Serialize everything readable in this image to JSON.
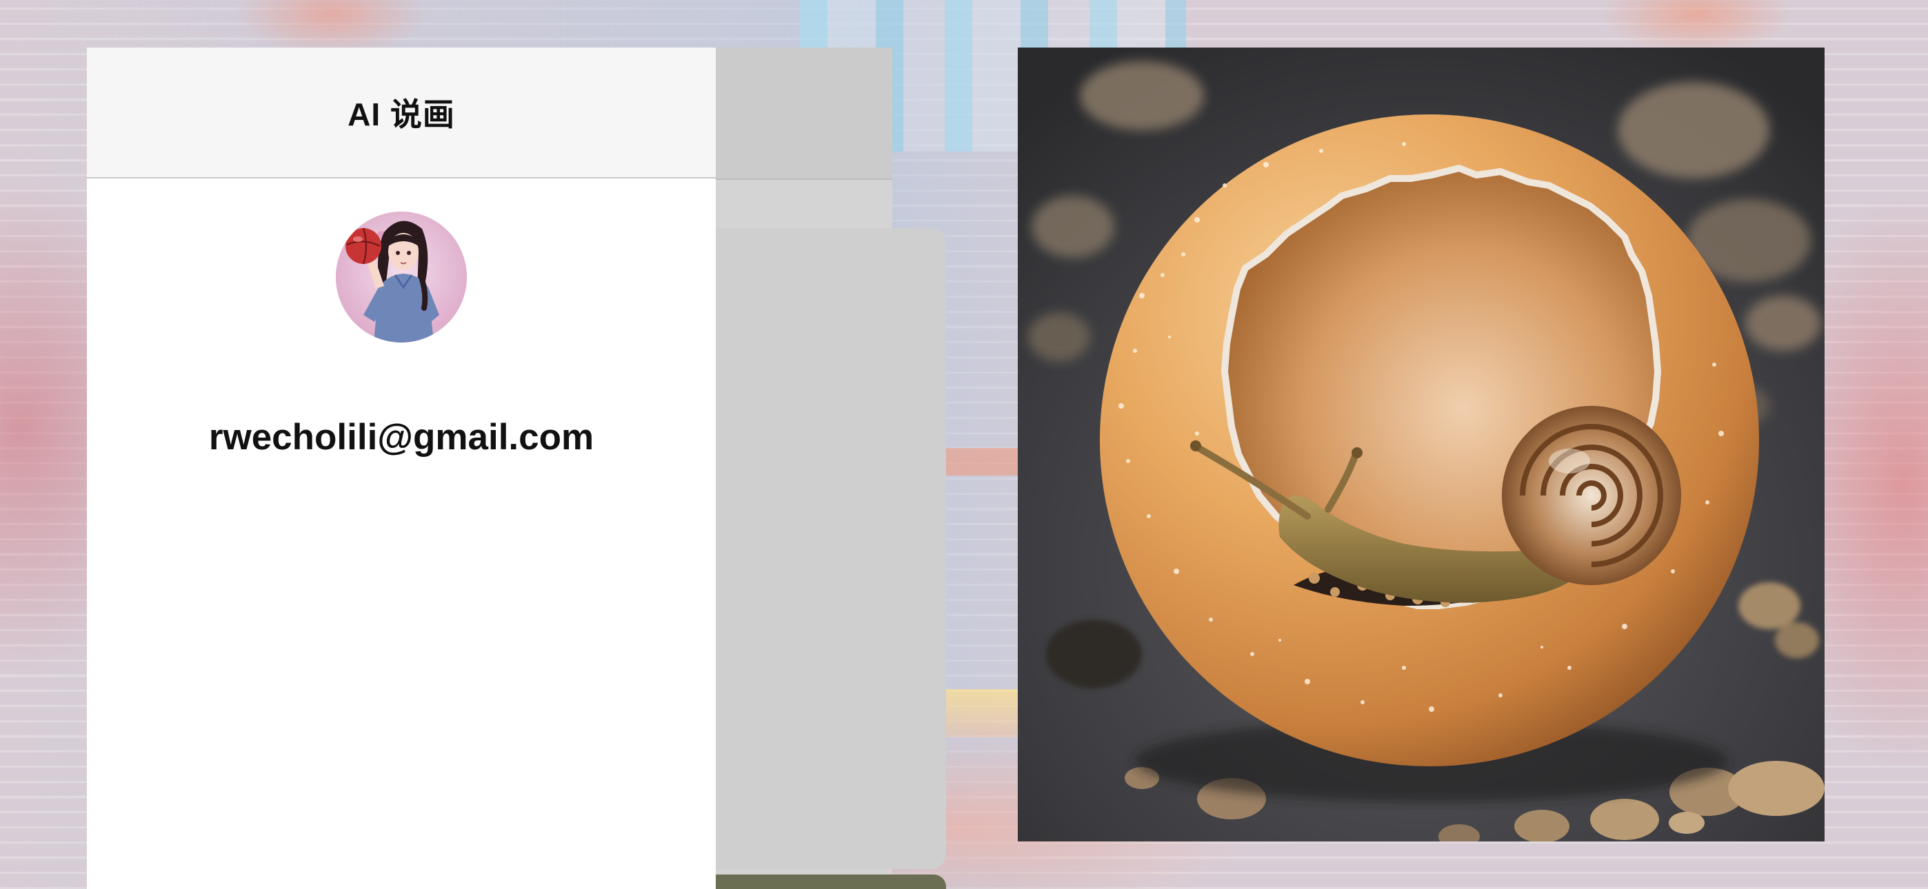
{
  "drawer": {
    "title": "AI 说画",
    "user": {
      "email": "rwecholili@gmail.com",
      "avatar_icon": "user-avatar-icon"
    }
  },
  "image_panel": {
    "subject": "snail-in-eggshell-image"
  },
  "colors": {
    "drawer_bg": "#ffffff",
    "drawer_header_bg": "#f6f6f6",
    "overlay_panel": "#d4d4d4",
    "text": "#111111"
  }
}
